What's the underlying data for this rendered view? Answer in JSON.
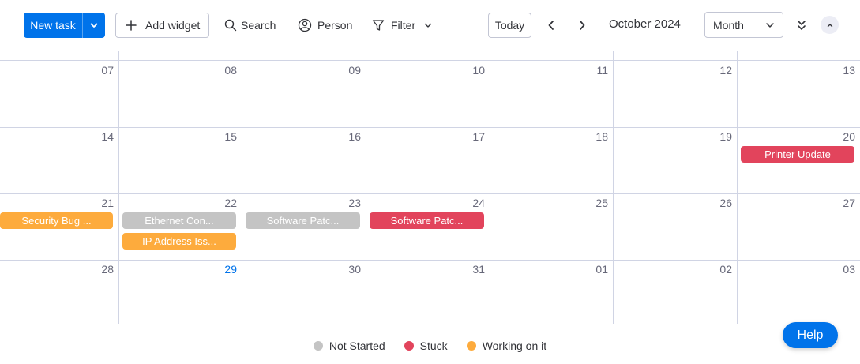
{
  "toolbar": {
    "new_task": "New task",
    "add_widget": "Add widget",
    "search": "Search",
    "person": "Person",
    "filter": "Filter",
    "today": "Today",
    "current_month": "October 2024",
    "view_select": "Month"
  },
  "calendar": {
    "rows": [
      [
        "07",
        "08",
        "09",
        "10",
        "11",
        "12",
        "13"
      ],
      [
        "14",
        "15",
        "16",
        "17",
        "18",
        "19",
        "20"
      ],
      [
        "21",
        "22",
        "23",
        "24",
        "25",
        "26",
        "27"
      ],
      [
        "28",
        "29",
        "30",
        "31",
        "01",
        "02",
        "03"
      ]
    ],
    "today": "29"
  },
  "events": [
    {
      "title": "Printer Update",
      "status": "Stuck",
      "row": 1,
      "col": 6,
      "slot": 0
    },
    {
      "title": "Security Bug ...",
      "status": "Working on it",
      "row": 2,
      "col": 0,
      "slot": 0
    },
    {
      "title": "Ethernet Con...",
      "status": "Not Started",
      "row": 2,
      "col": 1,
      "slot": 0
    },
    {
      "title": "IP Address Iss...",
      "status": "Working on it",
      "row": 2,
      "col": 1,
      "slot": 1
    },
    {
      "title": "Software Patc...",
      "status": "Not Started",
      "row": 2,
      "col": 2,
      "slot": 0
    },
    {
      "title": "Software Patc...",
      "status": "Stuck",
      "row": 2,
      "col": 3,
      "slot": 0
    }
  ],
  "legend": [
    {
      "label": "Not Started",
      "color": "#c4c4c4"
    },
    {
      "label": "Stuck",
      "color": "#e2445c"
    },
    {
      "label": "Working on it",
      "color": "#fdab3d"
    }
  ],
  "colors": {
    "primary": "#0073ea",
    "Not Started": "#c4c4c4",
    "Stuck": "#e2445c",
    "Working on it": "#fdab3d"
  },
  "help": "Help"
}
